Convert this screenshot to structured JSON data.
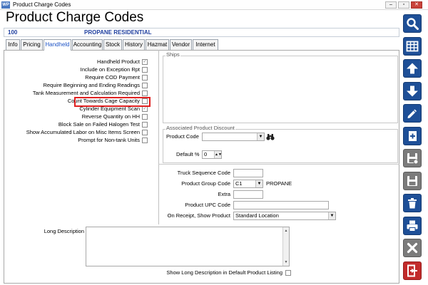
{
  "window": {
    "app_icon_text": "WP",
    "title": "Product Charge Codes",
    "controls": {
      "minimize": "–",
      "restore": "▫",
      "close": "✕"
    }
  },
  "page": {
    "heading": "Product Charge Codes"
  },
  "record": {
    "code": "100",
    "name": "PROPANE RESIDENTIAL"
  },
  "tabs": [
    {
      "label": "Info",
      "active": false
    },
    {
      "label": "Pricing",
      "active": false
    },
    {
      "label": "Handheld",
      "active": true
    },
    {
      "label": "Accounting",
      "active": false
    },
    {
      "label": "Stock",
      "active": false
    },
    {
      "label": "History",
      "active": false
    },
    {
      "label": "Hazmat",
      "active": false
    },
    {
      "label": "Vendor",
      "active": false
    },
    {
      "label": "Internet",
      "active": false
    }
  ],
  "options": [
    {
      "label": "Handheld Product",
      "checked": true
    },
    {
      "label": "Include on Exception Rpt",
      "checked": false
    },
    {
      "label": "Require COD Payment",
      "checked": false
    },
    {
      "label": "Require Beginning and Ending Readings",
      "checked": false
    },
    {
      "label": "Tank Measurement and Calculation Required",
      "checked": false
    },
    {
      "label": "Count Towards Cage Capacity",
      "checked": false
    },
    {
      "label": "Cylinder Equipment Scan",
      "checked": true
    },
    {
      "label": "Reverse Quantity on HH",
      "checked": false
    },
    {
      "label": "Block Sale on Failed Halogen Test",
      "checked": false
    },
    {
      "label": "Show Accumulated Labor on Misc Items Screen",
      "checked": false
    },
    {
      "label": "Prompt for Non-tank Units",
      "checked": false
    }
  ],
  "check_glyph": "✓",
  "ships": {
    "caption": "Ships"
  },
  "discount": {
    "caption": "Associated Product Discount",
    "product_code_label": "Product Code",
    "product_code_value": "",
    "binoculars_icon": "binoculars-icon",
    "default_pct_label": "Default %",
    "default_pct_value": "0"
  },
  "details": {
    "truck_seq_label": "Truck Sequence Code",
    "truck_seq_value": "",
    "group_code_label": "Product Group Code",
    "group_code_value": "C1",
    "group_code_desc": "PROPANE",
    "extra_label": "Extra",
    "extra_value": "",
    "upc_label": "Product UPC Code",
    "upc_value": "",
    "on_receipt_label": "On Receipt, Show Product",
    "on_receipt_value": "Standard Location"
  },
  "long_description": {
    "label": "Long Description",
    "value": "",
    "show_in_listing_label": "Show Long Description in Default Product Listing",
    "show_in_listing_checked": false
  },
  "sidebar": [
    {
      "name": "search",
      "style": "blue"
    },
    {
      "name": "grid",
      "style": "blue"
    },
    {
      "name": "up",
      "style": "blue"
    },
    {
      "name": "down",
      "style": "blue"
    },
    {
      "name": "edit",
      "style": "blue"
    },
    {
      "name": "add",
      "style": "blue"
    },
    {
      "name": "save-copy",
      "style": "grey"
    },
    {
      "name": "save",
      "style": "grey"
    },
    {
      "name": "delete",
      "style": "blue"
    },
    {
      "name": "print",
      "style": "blue"
    },
    {
      "name": "cancel",
      "style": "grey"
    },
    {
      "name": "exit",
      "style": "red"
    }
  ],
  "colors": {
    "accent": "#1e4f97",
    "active_tab": "#1f55c6",
    "highlight": "#e02020"
  }
}
